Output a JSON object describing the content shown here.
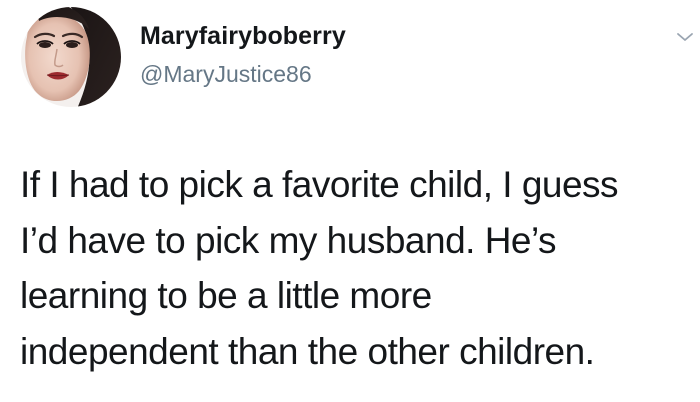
{
  "tweet": {
    "author": {
      "display_name": "Maryfairyboberry",
      "handle": "@MaryJustice86",
      "avatar_icon": "profile-photo"
    },
    "menu_icon": "chevron-down-icon",
    "text_lines": [
      "If I had to pick a favorite child, I guess",
      "I’d have to pick my husband. He’s",
      "learning to be a little more",
      "independent than the other children."
    ]
  },
  "colors": {
    "text": "#14171a",
    "secondary_text": "#657786",
    "background": "#ffffff"
  }
}
